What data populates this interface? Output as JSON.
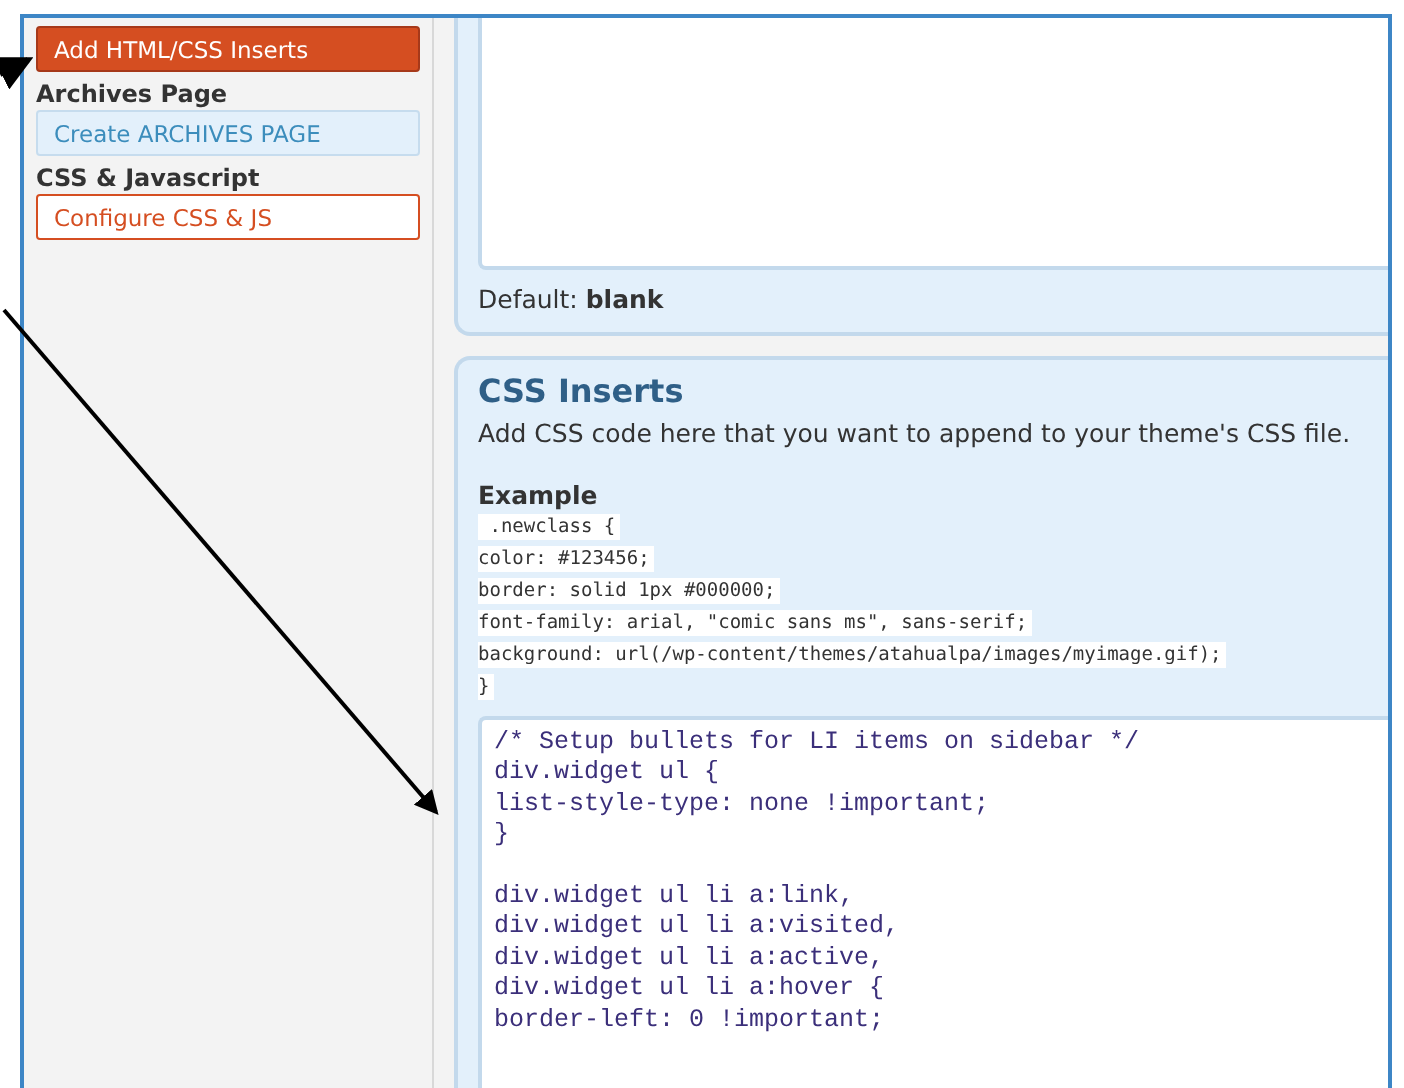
{
  "sidebar": {
    "items": [
      {
        "kind": "active",
        "label": "Add HTML/CSS Inserts"
      },
      {
        "kind": "heading",
        "label": "Archives Page"
      },
      {
        "kind": "plain",
        "label": "Create ARCHIVES PAGE"
      },
      {
        "kind": "heading",
        "label": "CSS & Javascript"
      },
      {
        "kind": "outline",
        "label": "Configure CSS & JS"
      }
    ]
  },
  "html_panel": {
    "default_note": "Default: **blank**"
  },
  "css_panel": {
    "title": "CSS Inserts",
    "description": "Add CSS code here that you want to append to your theme's CSS file.",
    "example_heading": "Example",
    "example_lines": [
      " .newclass {",
      "color: #123456;",
      "border: solid 1px #000000;",
      "font-family: arial, \"comic sans ms\", sans-serif;",
      "background: url(/wp-content/themes/atahualpa/images/myimage.gif);",
      "}"
    ],
    "code_blocks": [
      [
        "/* Setup bullets for LI items on sidebar */",
        "div.widget ul {",
        "list-style-type: none !important;",
        "}"
      ],
      [
        "div.widget ul li a:link,",
        "div.widget ul li a:visited,",
        "div.widget ul li a:active,",
        "div.widget ul li a:hover {",
        "border-left: 0 !important;"
      ]
    ]
  }
}
